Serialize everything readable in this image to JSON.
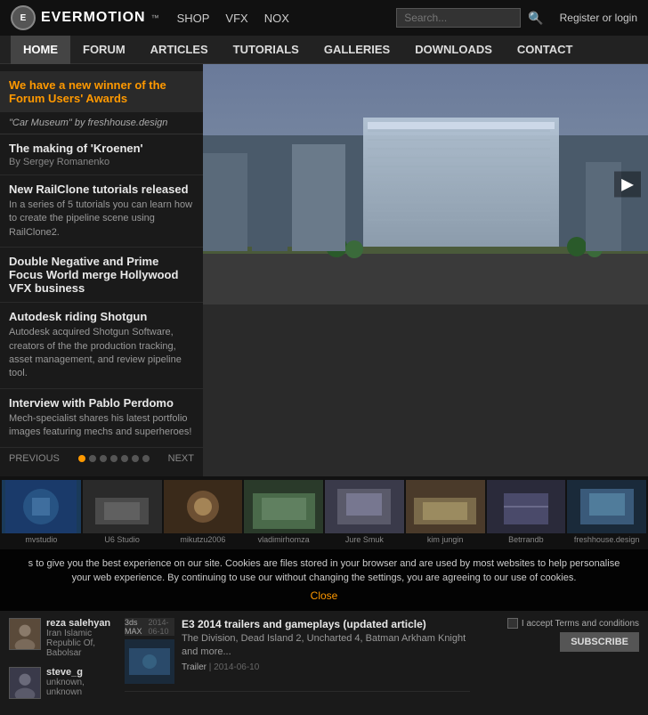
{
  "header": {
    "logo_text": "EVERMOTION",
    "logo_tm": "™",
    "nav_items": [
      "SHOP",
      "VFX",
      "NOX"
    ],
    "search_placeholder": "Search...",
    "register_text": "Register or login"
  },
  "main_nav": {
    "items": [
      "HOME",
      "FORUM",
      "ARTICLES",
      "TUTORIALS",
      "GALLERIES",
      "DOWNLOADS",
      "CONTACT"
    ],
    "active": "HOME"
  },
  "sidebar": {
    "highlight_text": "We have a new winner of the Forum Users' Awards",
    "highlight_quote": "\"Car Museum\" by freshhouse.design",
    "items": [
      {
        "title": "The making of 'Kroenen'",
        "sub": "By Sergey Romanenko",
        "desc": ""
      },
      {
        "title": "New RailClone tutorials released",
        "sub": "",
        "desc": "In a series of 5 tutorials you can learn how to create the pipeline scene using RailClone2."
      },
      {
        "title": "Double Negative and Prime Focus World merge Hollywood VFX business",
        "sub": "",
        "desc": ""
      },
      {
        "title": "Autodesk riding Shotgun",
        "sub": "",
        "desc": "Autodesk acquired Shotgun Software, creators of the the production tracking, asset management, and review pipeline tool."
      },
      {
        "title": "Interview with Pablo Perdomo",
        "sub": "",
        "desc": "Mech-specialist shares his latest portfolio images featuring mechs and superheroes!"
      }
    ],
    "prev_label": "PREVIOUS",
    "next_label": "NEXT",
    "dots_count": 7,
    "active_dot": 1
  },
  "thumbs": [
    {
      "label": "mvstudio",
      "color": "#1a3a5a"
    },
    {
      "label": "U6 Studio",
      "color": "#2a2a2a"
    },
    {
      "label": "mikutzu2006",
      "color": "#3a2a1a"
    },
    {
      "label": "vladimirhomza",
      "color": "#2a3a2a"
    },
    {
      "label": "Jure Smuk",
      "color": "#3a3a4a"
    },
    {
      "label": "kim jungin",
      "color": "#4a3a2a"
    },
    {
      "label": "Betrrandb",
      "color": "#2a2a3a"
    },
    {
      "label": "freshhouse.design",
      "color": "#1a2a3a"
    }
  ],
  "cookie_bar": {
    "text": "s to give you the best experience on our site. Cookies are files stored in your browser and are used by most websites to help personalise your web experience. By continuing to use our without changing the settings, you are agreeing to our use of cookies.",
    "close_label": "Close"
  },
  "users": [
    {
      "name": "reza salehyan",
      "location": "Iran Islamic Republic Of, Babolsar",
      "avatar_color": "#5a4a3a"
    },
    {
      "name": "steve_g",
      "location": "unknown, unknown",
      "avatar_color": "#3a3a4a"
    }
  ],
  "news": [
    {
      "title": "E3 2014 trailers and gameplays (updated article)",
      "desc": "The Division, Dead Island 2, Uncharted 4, Batman Arkham Knight and more...",
      "tag": "Trailer",
      "date": "2014-06-10",
      "thumb_color": "#2a3a4a",
      "format": "3ds MAX",
      "format_date": "2014-06-10"
    }
  ],
  "subscribe": {
    "checkbox_label": "I accept Terms and conditions",
    "button_label": "SUBSCRIBE"
  }
}
